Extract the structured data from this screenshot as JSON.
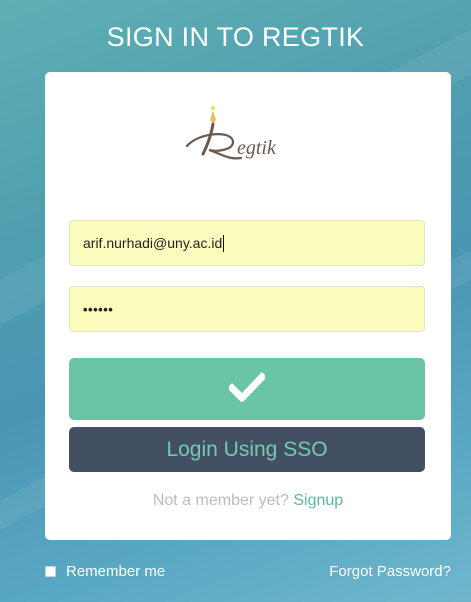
{
  "header": {
    "title": "SIGN IN TO REGTIK"
  },
  "logo": {
    "icon": "regtik-logo-icon"
  },
  "form": {
    "email_value": "arif.nurhadi@uny.ac.id",
    "password_mask": "••••••",
    "submit_icon": "checkmark-icon",
    "sso_label": "Login Using SSO"
  },
  "signup": {
    "prompt": "Not a member yet?",
    "link": "Signup"
  },
  "footer": {
    "remember_label": "Remember me",
    "forgot_label": "Forgot Password?"
  },
  "colors": {
    "background": "#4f9fb0",
    "submit_button": "#6ac5a5",
    "sso_button": "#435063",
    "sso_text": "#72cbb1",
    "input_fill": "#fbfdbd",
    "link": "#5cb8a3"
  }
}
